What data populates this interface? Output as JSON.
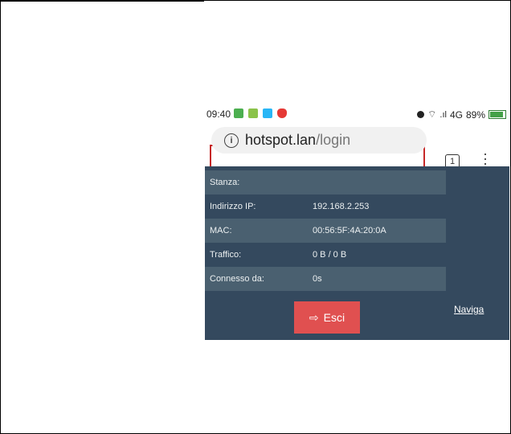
{
  "status": {
    "time": "09:40",
    "signal": "4G",
    "battery": "89%"
  },
  "browser": {
    "url_host": "hotspot.lan",
    "url_path": "/login",
    "tab_count": "1"
  },
  "portal": {
    "rows": [
      {
        "label": "Stanza:",
        "value": ""
      },
      {
        "label": "Indirizzo IP:",
        "value": "192.168.2.253"
      },
      {
        "label": "MAC:",
        "value": "00:56:5F:4A:20:0A"
      },
      {
        "label": "Traffico:",
        "value": "0 B / 0 B"
      },
      {
        "label": "Connesso da:",
        "value": "0s"
      }
    ],
    "logout_label": "Esci",
    "browse_label": "Naviga"
  },
  "colors": {
    "portal_bg": "#34495e",
    "accent": "#e05050",
    "highlight_border": "#c62828"
  }
}
